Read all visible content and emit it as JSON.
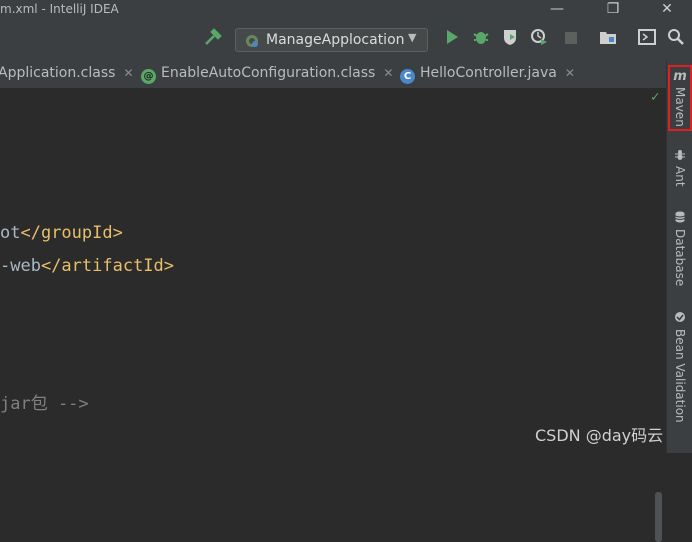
{
  "window": {
    "title": "m.xml - IntelliJ IDEA",
    "minimize": "—",
    "restore": "❐",
    "close": "✕"
  },
  "toolbar": {
    "run_config": "ManageApplocation",
    "icons": [
      "build-hammer",
      "run",
      "debug",
      "coverage",
      "profile",
      "stop",
      "project-structure",
      "run-anything",
      "search"
    ]
  },
  "tabs": [
    {
      "label": "Application.class",
      "icon": "",
      "active": false
    },
    {
      "label": "EnableAutoConfiguration.class",
      "icon": "@",
      "active": false
    },
    {
      "label": "HelloController.java",
      "icon": "C",
      "active": false
    }
  ],
  "editor": {
    "lines": [
      {
        "before": "ot",
        "tag": "</groupId>"
      },
      {
        "before": "-web",
        "tag": "</artifactId>"
      },
      {
        "comment": "jar包 -->"
      }
    ],
    "status_icon": "✓"
  },
  "right_toolbar": [
    {
      "label": "Maven",
      "icon": "m",
      "highlighted": true
    },
    {
      "label": "Ant",
      "icon": "ant"
    },
    {
      "label": "Database",
      "icon": "database"
    },
    {
      "label": "Bean Validation",
      "icon": "bean"
    }
  ],
  "watermark": "CSDN @day码云",
  "colors": {
    "editor_bg": "#2b2b2b",
    "chrome_bg": "#3c3f41",
    "tag": "#e8bf6a",
    "text": "#a9b7c6",
    "comment": "#808080",
    "highlight": "#e02020",
    "run_green": "#59a869"
  }
}
